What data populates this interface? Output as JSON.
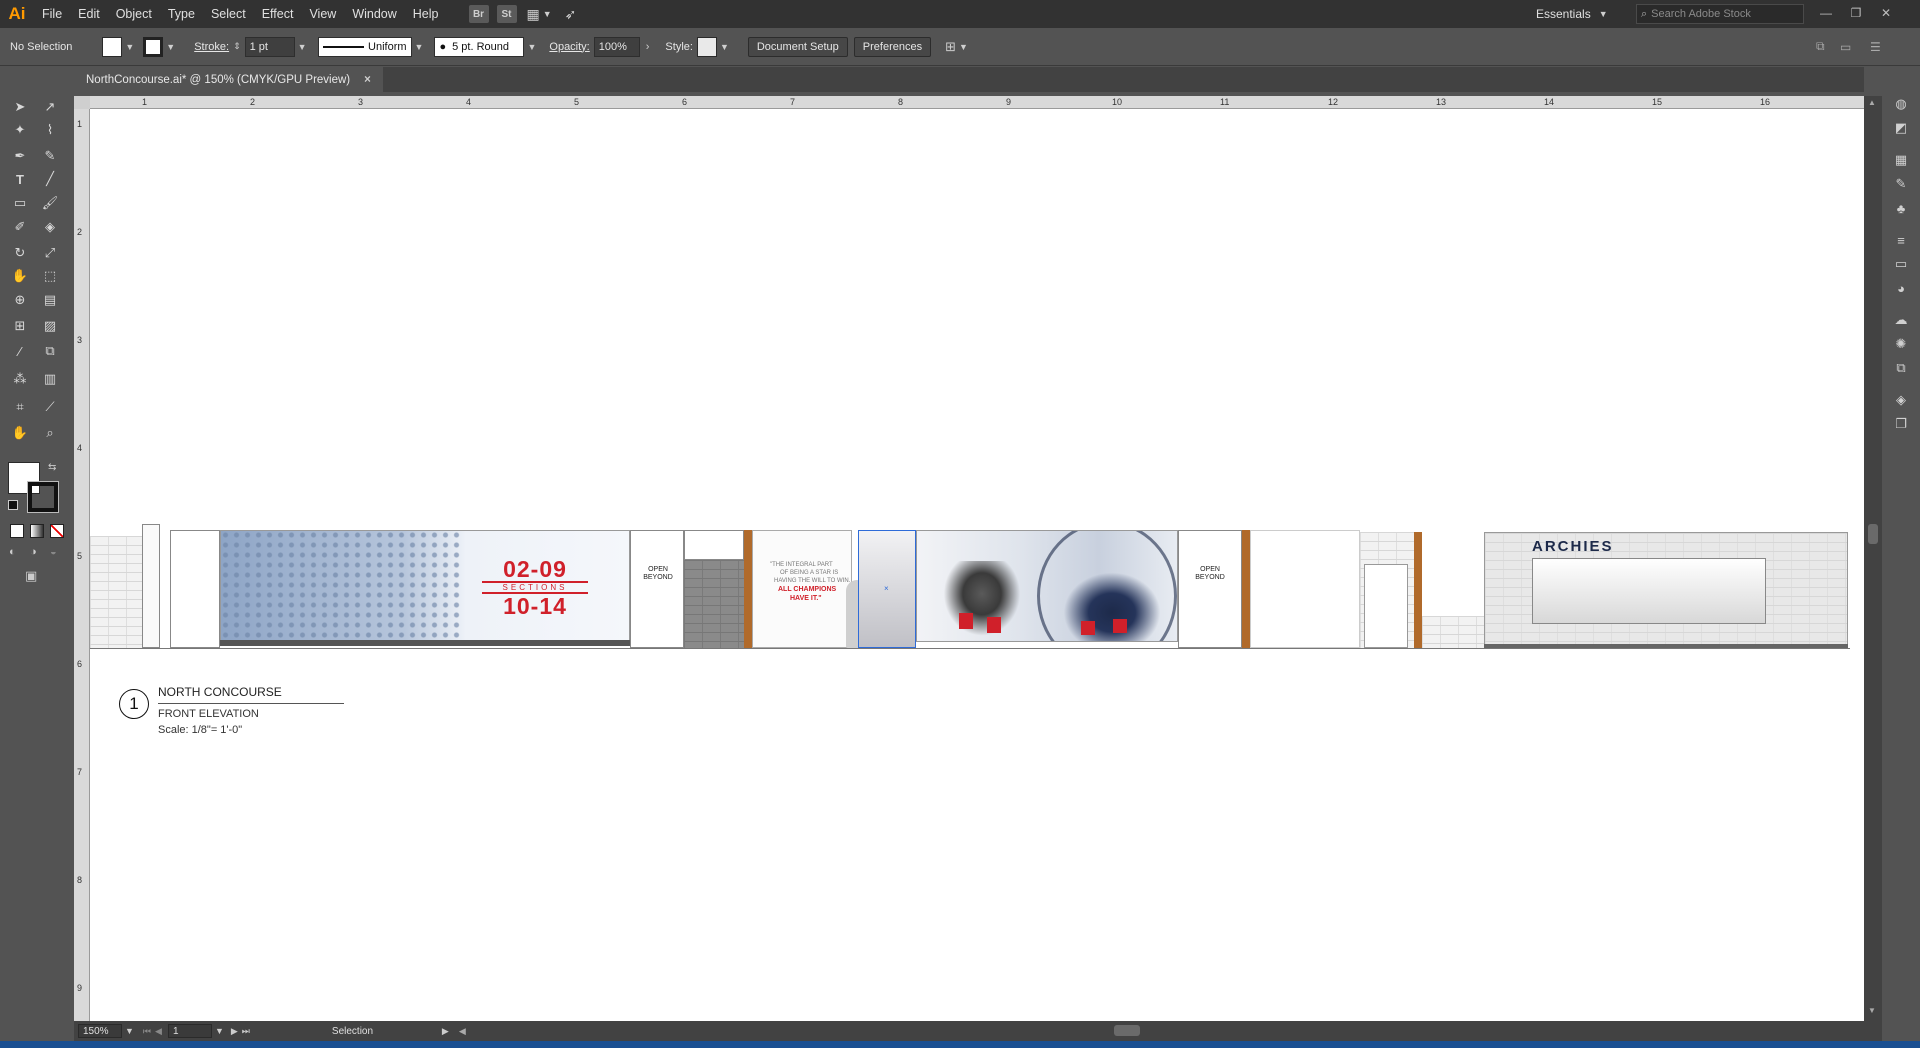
{
  "menubar": {
    "app_logo": "Ai",
    "items": [
      "File",
      "Edit",
      "Object",
      "Type",
      "Select",
      "Effect",
      "View",
      "Window",
      "Help"
    ],
    "bridge_label": "Br",
    "stock_label": "St",
    "workspace": "Essentials",
    "search_placeholder": "Search Adobe Stock"
  },
  "controlbar": {
    "selection_status": "No Selection",
    "stroke_label": "Stroke:",
    "stroke_weight": "1 pt",
    "stroke_profile": "Uniform",
    "brush": "5 pt. Round",
    "opacity_label": "Opacity:",
    "opacity_value": "100%",
    "style_label": "Style:",
    "document_setup": "Document Setup",
    "preferences": "Preferences"
  },
  "document": {
    "tab_title": "NorthConcourse.ai* @ 150% (CMYK/GPU Preview)",
    "tab_close": "×"
  },
  "rulers": {
    "top": [
      "1",
      "2",
      "3",
      "4",
      "5",
      "6",
      "7",
      "8",
      "9",
      "10",
      "11",
      "12",
      "13",
      "14",
      "15",
      "16"
    ],
    "left": [
      "1",
      "2",
      "3",
      "4",
      "5",
      "6",
      "7",
      "8",
      "9"
    ]
  },
  "elevation": {
    "marker_number": "1",
    "title": "NORTH CONCOURSE",
    "subtitle": "FRONT ELEVATION",
    "scale": "Scale: 1/8\"= 1'-0\"",
    "sections_top": "02-09",
    "sections_label": "SECTIONS",
    "sections_bottom": "10-14",
    "open_beyond_1": "OPEN BEYOND",
    "open_beyond_2": "OPEN BEYOND",
    "quote_lines": [
      "\"THE INTEGRAL PART",
      "OF BEING A STAR IS",
      "HAVING THE WILL TO WIN.",
      "ALL CHAMPIONS",
      "HAVE IT.\""
    ],
    "archies": "ARCHIES"
  },
  "statusbar": {
    "zoom": "150%",
    "artboard": "1",
    "tool_status": "Selection"
  },
  "colors": {
    "app_accent": "#ff9a00",
    "sign_red": "#d0202a",
    "mural_blue": "#9fb3d1",
    "wood": "#b06a2b"
  }
}
